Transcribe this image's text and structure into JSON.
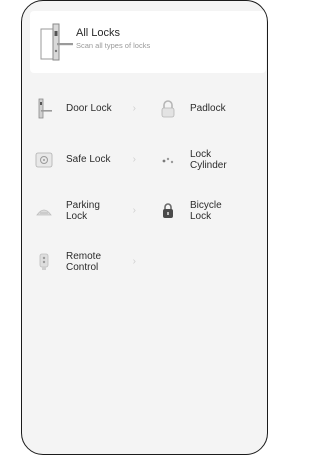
{
  "header": {
    "title": "All Locks",
    "subtitle": "Scan all types of locks",
    "icon": "door-handle-icon"
  },
  "categories": [
    {
      "label": "Door Lock",
      "icon": "door-lock-icon",
      "has_chevron": true
    },
    {
      "label": "Padlock",
      "icon": "padlock-icon",
      "has_chevron": false
    },
    {
      "label": "Safe Lock",
      "icon": "safe-lock-icon",
      "has_chevron": true
    },
    {
      "label": "Lock\nCylinder",
      "icon": "lock-cylinder-icon",
      "has_chevron": false
    },
    {
      "label": "Parking\nLock",
      "icon": "parking-lock-icon",
      "has_chevron": true
    },
    {
      "label": "Bicycle\nLock",
      "icon": "bicycle-lock-icon",
      "has_chevron": false
    },
    {
      "label": "Remote\nControl",
      "icon": "remote-control-icon",
      "has_chevron": true
    }
  ],
  "chevron_glyph": "›",
  "colors": {
    "background": "#f4f4f4",
    "card": "#ffffff",
    "text": "#2c2c2c",
    "muted": "#9a9a9a",
    "frame": "#1b1b1b"
  }
}
